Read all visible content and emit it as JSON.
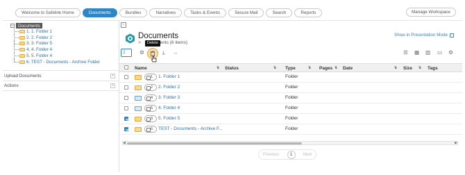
{
  "topnav": {
    "tabs": [
      {
        "label": "Welcome to Safelink Home",
        "active": false
      },
      {
        "label": "Documents",
        "active": true
      },
      {
        "label": "Bundles",
        "active": false
      },
      {
        "label": "Narratives",
        "active": false
      },
      {
        "label": "Tasks & Events",
        "active": false
      },
      {
        "label": "Secure Mail",
        "active": false
      },
      {
        "label": "Search",
        "active": false
      },
      {
        "label": "Reports",
        "active": false
      }
    ],
    "manage_label": "Manage Workspace"
  },
  "tree": {
    "root_label": "Documents",
    "items": [
      "1. 1. Folder 1",
      "2. 2. Folder 2",
      "3. 3. Folder 5",
      "4. 4. Folder 4",
      "5. 5. Folder 4",
      "6. TEST - Documents - Archive Folder"
    ]
  },
  "left_sections": {
    "upload": "Upload Documents",
    "actions": "Actions",
    "expand_symbol": "+"
  },
  "header": {
    "title": "Documents",
    "subtitle_prefix": ">",
    "subtitle_rest": "uments (6 items)",
    "presentation_link": "Show in Presentation Mode"
  },
  "toolbar": {
    "page_value": "2",
    "tooltip": "Delete"
  },
  "table": {
    "columns": [
      "Name",
      "Status",
      "Type",
      "Pages",
      "Date",
      "Size",
      "Tags"
    ],
    "rows": [
      {
        "badge": "1",
        "name": "1. Folder 1",
        "type": "Folder",
        "checked": false,
        "icon": "folder"
      },
      {
        "badge": "2",
        "name": "2. Folder 2",
        "type": "Folder",
        "checked": false,
        "icon": "folder"
      },
      {
        "badge": "4",
        "name": "3. Folder 3",
        "type": "Folder",
        "checked": false,
        "icon": "folder-alt"
      },
      {
        "badge": "5",
        "name": "4. Folder 4",
        "type": "Folder",
        "checked": false,
        "icon": "folder-alt"
      },
      {
        "badge": "3",
        "name": "5. Folder 5",
        "type": "Folder",
        "checked": true,
        "icon": "folder"
      },
      {
        "badge": "6",
        "name": "TEST - Documents - Archive F...",
        "type": "Folder",
        "checked": true,
        "icon": "folder"
      }
    ]
  },
  "pager": {
    "prev": "Previous",
    "page": "1",
    "next": "Next"
  },
  "colors": {
    "accent": "#2f86c6",
    "link": "#2f6fb4",
    "folder": "#fbd98b",
    "delete_highlight": "#f6dcb0"
  }
}
